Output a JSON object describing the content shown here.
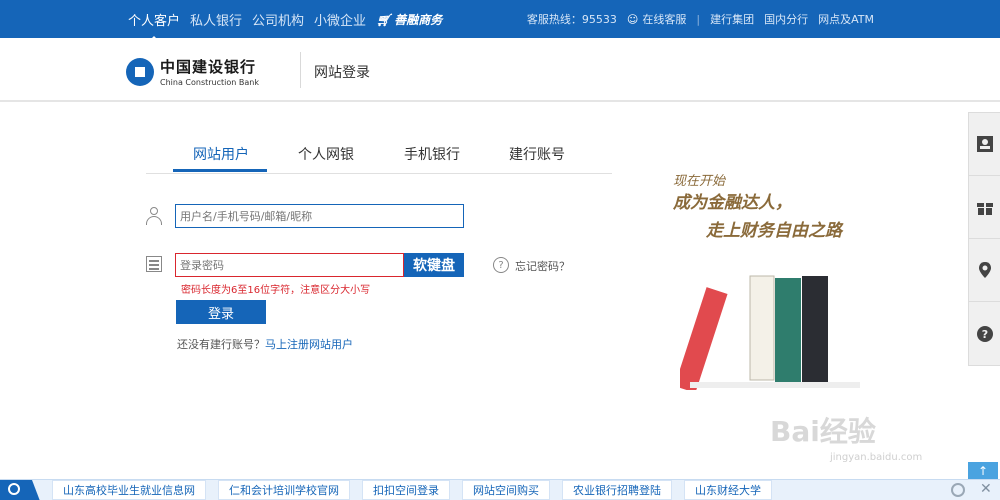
{
  "topbar": {
    "nav": [
      "个人客户",
      "私人银行",
      "公司机构",
      "小微企业"
    ],
    "shop": "善融商务",
    "hotline": "客服热线：95533",
    "online": "在线客服",
    "links": [
      "建行集团",
      "国内分行",
      "网点及ATM"
    ]
  },
  "header": {
    "logo_cn": "中国建设银行",
    "logo_en": "China Construction Bank",
    "title": "网站登录"
  },
  "tabs": [
    "网站用户",
    "个人网银",
    "手机银行",
    "建行账号"
  ],
  "form": {
    "username_placeholder": "用户名/手机号码/邮箱/昵称",
    "password_placeholder": "登录密码",
    "softkbd": "软键盘",
    "forgot": "忘记密码？",
    "error": "密码长度为6至16位字符，注意区分大小写",
    "login": "登录",
    "register_prefix": "还没有建行账号？",
    "register_link": "马上注册网站用户"
  },
  "promo": {
    "line1": "现在开始",
    "line2": "成为金融达人，",
    "line3": "走上财务自由之路"
  },
  "watermark": {
    "text": "Bai经验",
    "url": "jingyan.baidu.com"
  },
  "bottom_links": [
    "山东高校毕业生就业信息网",
    "仁和会计培训学校官网",
    "扣扣空间登录",
    "网站空间购买",
    "农业银行招聘登陆",
    "山东财经大学"
  ],
  "icons": {
    "sidebar": [
      "id-card-icon",
      "gift-icon",
      "location-icon",
      "help-icon"
    ]
  },
  "colors": {
    "brand": "#1565b8",
    "error": "#d9262e",
    "promo": "#8a6a3a"
  }
}
